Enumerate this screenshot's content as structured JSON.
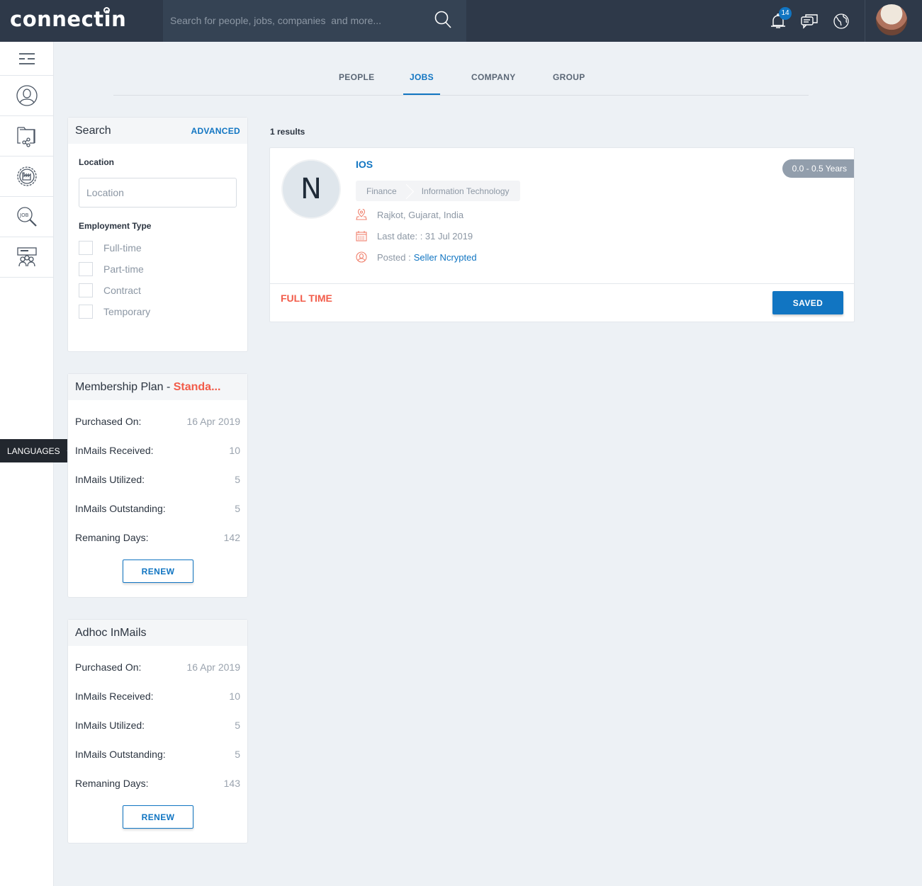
{
  "header": {
    "logo": "connectin",
    "search_placeholder": "Search for people, jobs, companies  and more...",
    "notification_count": "14",
    "icons": [
      "search-icon",
      "bell-icon",
      "chat-icon",
      "globe-icon",
      "avatar"
    ]
  },
  "sidebar": {
    "items": [
      {
        "icon": "menu-icon"
      },
      {
        "icon": "user-profile-icon"
      },
      {
        "icon": "shared-folder-icon"
      },
      {
        "icon": "company-factory-icon"
      },
      {
        "icon": "job-search-icon"
      },
      {
        "icon": "group-presentation-icon"
      }
    ],
    "languages_label": "LANGUAGES"
  },
  "tabs": [
    {
      "label": "PEOPLE",
      "active": false
    },
    {
      "label": "JOBS",
      "active": true
    },
    {
      "label": "COMPANY",
      "active": false
    },
    {
      "label": "GROUP",
      "active": false
    }
  ],
  "search_panel": {
    "title": "Search",
    "advanced_label": "ADVANCED",
    "location_label": "Location",
    "location_placeholder": "Location",
    "location_value": "",
    "employment_type_label": "Employment Type",
    "employment_types": [
      {
        "label": "Full-time",
        "checked": false
      },
      {
        "label": "Part-time",
        "checked": false
      },
      {
        "label": "Contract",
        "checked": false
      },
      {
        "label": "Temporary",
        "checked": false
      }
    ]
  },
  "membership_plan": {
    "title": "Membership Plan - ",
    "plan_name": "Standa...",
    "rows": [
      {
        "label": "Purchased On:",
        "value": "16 Apr 2019"
      },
      {
        "label": "InMails Received:",
        "value": "10"
      },
      {
        "label": "InMails Utilized:",
        "value": "5"
      },
      {
        "label": "InMails Outstanding:",
        "value": "5"
      },
      {
        "label": "Remaning Days:",
        "value": "142"
      }
    ],
    "renew_label": "RENEW"
  },
  "adhoc_inmails": {
    "title": "Adhoc InMails",
    "rows": [
      {
        "label": "Purchased On:",
        "value": "16 Apr 2019"
      },
      {
        "label": "InMails Received:",
        "value": "10"
      },
      {
        "label": "InMails Utilized:",
        "value": "5"
      },
      {
        "label": "InMails Outstanding:",
        "value": "5"
      },
      {
        "label": "Remaning Days:",
        "value": "143"
      }
    ],
    "renew_label": "RENEW"
  },
  "results": {
    "count_text": "1 results",
    "jobs": [
      {
        "logo_letter": "N",
        "title": "IOS",
        "categories": [
          "Finance",
          "Information Technology"
        ],
        "location": "Rajkot, Gujarat, India",
        "last_date": "Last date: : 31 Jul 2019",
        "posted_label": "Posted :",
        "posted_by": "Seller Ncrypted",
        "experience": "0.0 - 0.5 Years",
        "job_type": "FULL TIME",
        "saved_label": "SAVED"
      }
    ]
  },
  "colors": {
    "topbar": "#2e3949",
    "accent": "#1175c2",
    "highlight": "#f25c4a",
    "background": "#edf1f5"
  }
}
